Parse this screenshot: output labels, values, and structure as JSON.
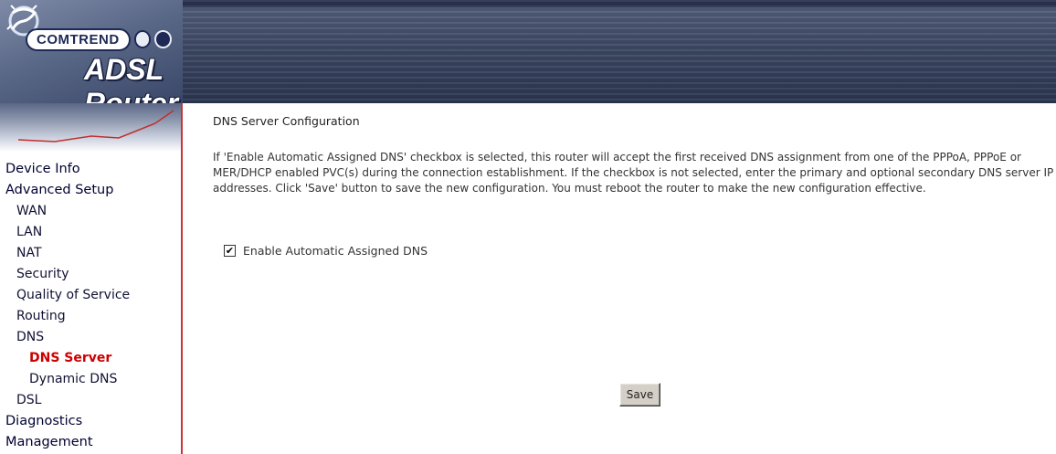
{
  "header": {
    "brand": "COMTREND",
    "product": "ADSL Router"
  },
  "sidebar": {
    "items": [
      {
        "label": "Device Info",
        "level": 1,
        "active": false
      },
      {
        "label": "Advanced Setup",
        "level": 1,
        "active": false
      },
      {
        "label": "WAN",
        "level": 2,
        "active": false
      },
      {
        "label": "LAN",
        "level": 2,
        "active": false
      },
      {
        "label": "NAT",
        "level": 2,
        "active": false
      },
      {
        "label": "Security",
        "level": 2,
        "active": false
      },
      {
        "label": "Quality of Service",
        "level": 2,
        "active": false
      },
      {
        "label": "Routing",
        "level": 2,
        "active": false
      },
      {
        "label": "DNS",
        "level": 2,
        "active": false
      },
      {
        "label": "DNS Server",
        "level": 3,
        "active": true
      },
      {
        "label": "Dynamic DNS",
        "level": 3,
        "active": false
      },
      {
        "label": "DSL",
        "level": 2,
        "active": false
      },
      {
        "label": "Diagnostics",
        "level": 1,
        "active": false
      },
      {
        "label": "Management",
        "level": 1,
        "active": false
      }
    ]
  },
  "main": {
    "title": "DNS Server Configuration",
    "description": "If 'Enable Automatic Assigned DNS' checkbox is selected, this router will accept the first received DNS assignment from one of the PPPoA, PPPoE or MER/DHCP enabled PVC(s) during the connection establishment. If the checkbox is not selected, enter the primary and optional secondary DNS server IP addresses. Click 'Save' button to save the new configuration. You must reboot the router to make the new configuration effective.",
    "auto_dns_label": "Enable Automatic Assigned DNS",
    "auto_dns_checked": true,
    "save_label": "Save"
  },
  "colors": {
    "active_nav": "#cc0000",
    "sidebar_border": "#cc3333",
    "header_bg": "#3f4a66"
  }
}
